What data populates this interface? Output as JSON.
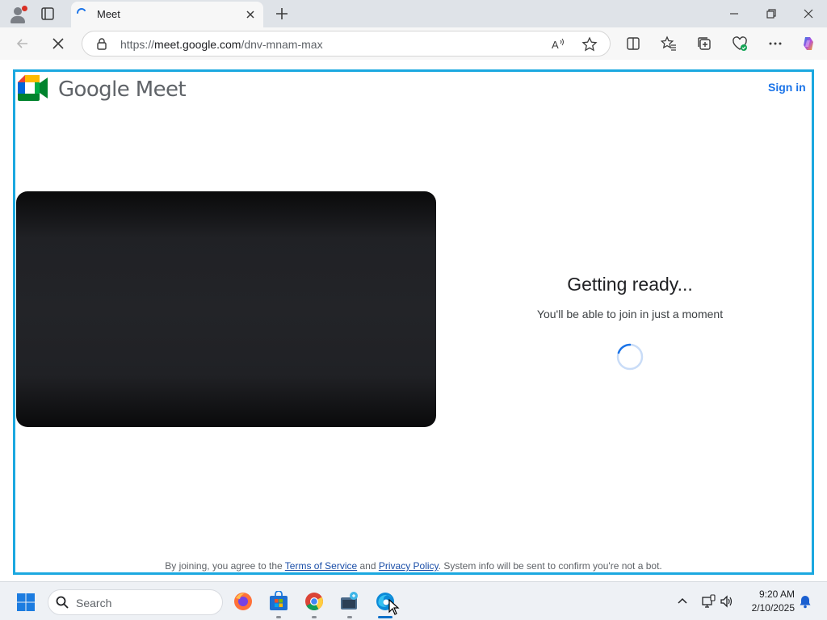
{
  "browser": {
    "tab": {
      "title": "Meet"
    },
    "address": {
      "scheme": "https://",
      "host": "meet.google.com",
      "path": "/dnv-mnam-max"
    }
  },
  "page": {
    "brand": "Google Meet",
    "sign_in": "Sign in",
    "status_title": "Getting ready...",
    "status_subtitle": "You'll be able to join in just a moment",
    "legal": {
      "prefix": "By joining, you agree to the ",
      "terms": "Terms of Service",
      "and": " and ",
      "privacy": "Privacy Policy",
      "suffix": ". System info will be sent to confirm you're not a bot."
    }
  },
  "taskbar": {
    "search_label": "Search",
    "time": "9:20 AM",
    "date": "2/10/2025",
    "apps": [
      "firefox-icon",
      "microsoft-store-icon",
      "chrome-icon",
      "file-manager-icon",
      "edge-icon"
    ]
  },
  "colors": {
    "frame_highlight": "#1ba8e0",
    "link_blue": "#1a73e8",
    "meet_green": "#00832d",
    "meet_blue": "#0066da",
    "meet_red": "#e94235",
    "meet_yellow": "#ffba00"
  }
}
